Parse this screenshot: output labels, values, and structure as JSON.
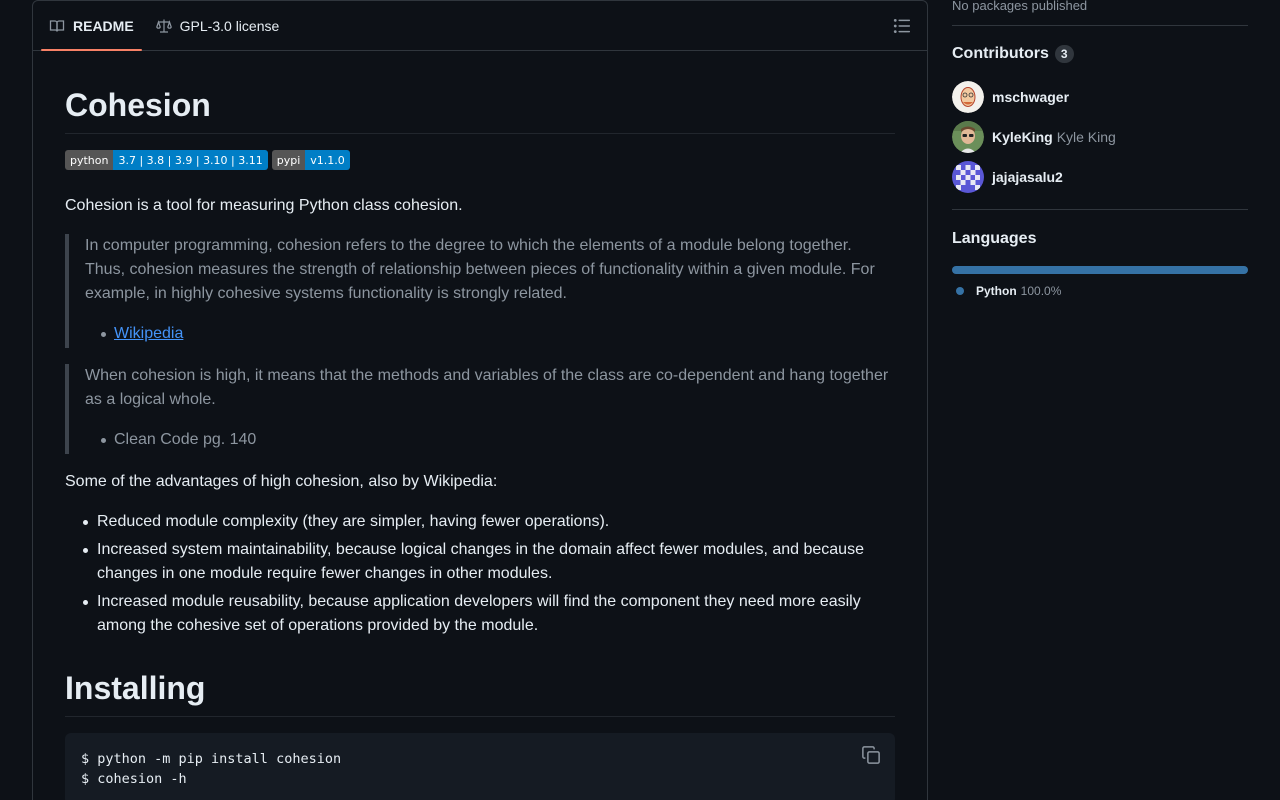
{
  "readme": {
    "tabs": [
      {
        "label": "README",
        "icon": "book-icon",
        "active": true
      },
      {
        "label": "GPL-3.0 license",
        "icon": "scale-icon",
        "active": false
      }
    ],
    "title": "Cohesion",
    "badges": [
      {
        "left": "python",
        "right": "3.7 | 3.8 | 3.9 | 3.10 | 3.11"
      },
      {
        "left": "pypi",
        "right": "v1.1.0"
      }
    ],
    "intro": "Cohesion is a tool for measuring Python class cohesion.",
    "quote1": "In computer programming, cohesion refers to the degree to which the elements of a module belong together. Thus, cohesion measures the strength of relationship between pieces of functionality within a given module. For example, in highly cohesive systems functionality is strongly related.",
    "quote1_source": "Wikipedia",
    "quote2": "When cohesion is high, it means that the methods and variables of the class are co-dependent and hang together as a logical whole.",
    "quote2_source": "Clean Code pg. 140",
    "advantages_intro": "Some of the advantages of high cohesion, also by Wikipedia:",
    "advantages": [
      "Reduced module complexity (they are simpler, having fewer operations).",
      "Increased system maintainability, because logical changes in the domain affect fewer modules, and because changes in one module require fewer changes in other modules.",
      "Increased module reusability, because application developers will find the component they need more easily among the cohesive set of operations provided by the module."
    ],
    "install_title": "Installing",
    "code_lines": [
      "$ python -m pip install cohesion",
      "$ cohesion -h"
    ]
  },
  "sidebar": {
    "packages_text": "No packages published",
    "contributors_title": "Contributors",
    "contributors_count": "3",
    "contributors": [
      {
        "login": "mschwager",
        "name": ""
      },
      {
        "login": "KyleKing",
        "name": "Kyle King"
      },
      {
        "login": "jajajasalu2",
        "name": ""
      }
    ],
    "languages_title": "Languages",
    "languages": [
      {
        "name": "Python",
        "percent": "100.0%",
        "color": "#3572A5"
      }
    ]
  },
  "colors": {
    "tab_underline": "#f78166",
    "link": "#4493f8",
    "badge_left": "#555555",
    "badge_right": "#007ec6"
  }
}
